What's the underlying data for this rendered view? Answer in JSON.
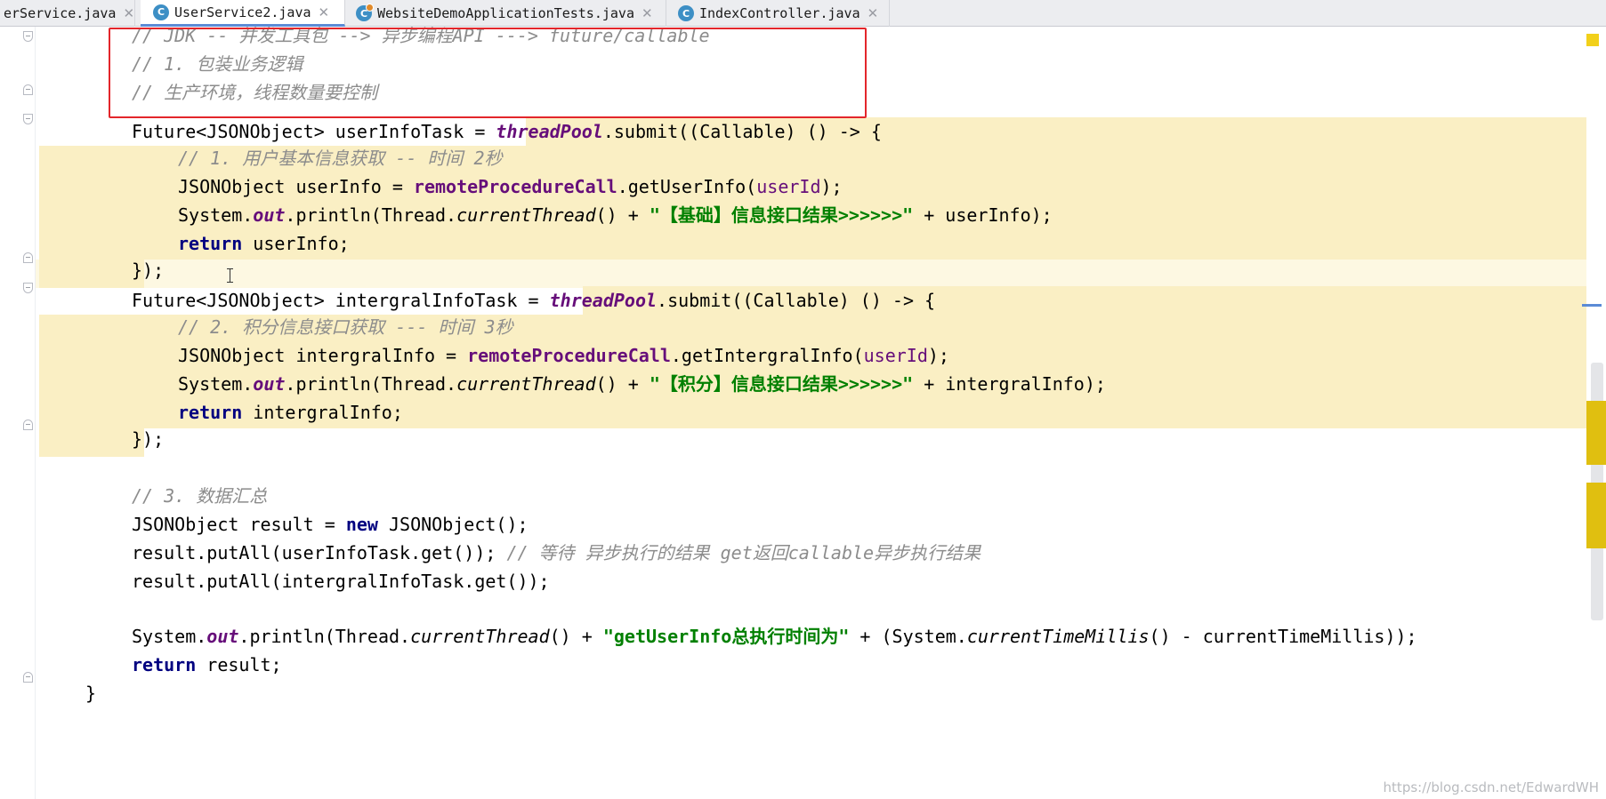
{
  "tabs": [
    {
      "label": "erService.java",
      "icon": "java-class-icon"
    },
    {
      "label": "UserService2.java",
      "icon": "java-class-icon"
    },
    {
      "label": "WebsiteDemoApplicationTests.java",
      "icon": "java-test-class-icon"
    },
    {
      "label": "IndexController.java",
      "icon": "java-class-icon"
    }
  ],
  "close_glyph": "✕",
  "tab_icon_letter": "C",
  "active_tab_index": 1,
  "colors": {
    "highlight": "#faefc4",
    "annotation_box": "#e3262b",
    "comment": "#8c8c8c",
    "keyword": "#000080",
    "field": "#660e7a",
    "string": "#008000"
  },
  "code": {
    "l1": "// JDK -- 并发工具包 --> 异步编程API ---> future/callable",
    "l2": "// 1. 包装业务逻辑",
    "l3": "// 生产环境，线程数量要控制",
    "l4": {
      "a": "Future<JSONObject> userInfoTask = ",
      "b": "threadPool",
      "c": ".submit((Callable) () -> {"
    },
    "l5": "// 1. 用户基本信息获取 -- 时间 2秒",
    "l6": {
      "a": "JSONObject userInfo = ",
      "b": "remoteProcedureCall",
      "c": ".getUserInfo(",
      "d": "userId",
      "e": ");"
    },
    "l7": {
      "a": "System.",
      "b": "out",
      "c": ".println(Thread.",
      "d": "currentThread",
      "e": "() + ",
      "f": "\"【基础】信息接口结果>>>>>>\"",
      "g": " + userInfo);"
    },
    "l8": {
      "a": "return",
      "b": " userInfo;"
    },
    "l9": "});",
    "l10": {
      "a": "Future<JSONObject> intergralInfoTask = ",
      "b": "threadPool",
      "c": ".submit((Callable) () -> {"
    },
    "l11": "// 2. 积分信息接口获取 --- 时间 3秒",
    "l12": {
      "a": "JSONObject intergralInfo = ",
      "b": "remoteProcedureCall",
      "c": ".getIntergralInfo(",
      "d": "userId",
      "e": ");"
    },
    "l13": {
      "a": "System.",
      "b": "out",
      "c": ".println(Thread.",
      "d": "currentThread",
      "e": "() + ",
      "f": "\"【积分】信息接口结果>>>>>>\"",
      "g": " + intergralInfo);"
    },
    "l14": {
      "a": "return",
      "b": " intergralInfo;"
    },
    "l15": "});",
    "l16": "// 3. 数据汇总",
    "l17": {
      "a": "JSONObject result = ",
      "b": "new",
      "c": " JSONObject();"
    },
    "l18": {
      "a": "result.putAll(userInfoTask.get()); ",
      "b": "// 等待 异步执行的结果 get返回callable异步执行结果"
    },
    "l19": "result.putAll(intergralInfoTask.get());",
    "l20": {
      "a": "System.",
      "b": "out",
      "c": ".println(Thread.",
      "d": "currentThread",
      "e": "() + ",
      "f": "\"getUserInfo总执行时间为\"",
      "g": " + (System.",
      "h": "currentTimeMillis",
      "i": "() - currentTimeMillis));"
    },
    "l21": {
      "a": "return",
      "b": " result;"
    },
    "l22": "}"
  },
  "watermark": "https://blog.csdn.net/EdwardWH"
}
